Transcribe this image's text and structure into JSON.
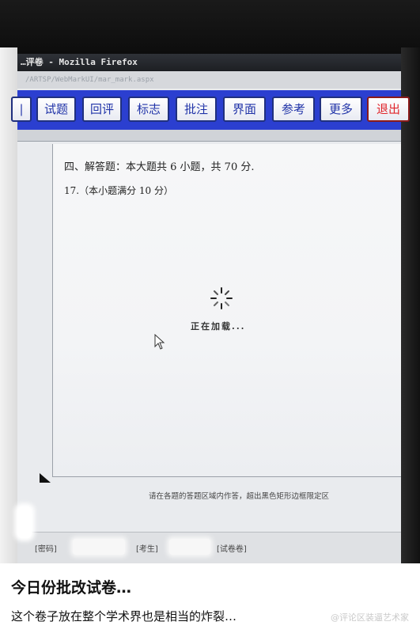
{
  "window": {
    "title": "…评卷 - Mozilla Firefox",
    "url": "/ARTSP/WebMarkUI/mar_mark.aspx"
  },
  "toolbar": {
    "buttons": [
      {
        "label": "|"
      },
      {
        "label": "试题"
      },
      {
        "label": "回评"
      },
      {
        "label": "标志"
      },
      {
        "label": "批注"
      },
      {
        "label": "界面"
      },
      {
        "label": "参考"
      },
      {
        "label": "更多"
      },
      {
        "label": "退出"
      }
    ]
  },
  "paper": {
    "section_heading": "四、解答题：本大题共 6 小题，共 70 分.",
    "question_label": "17.（本小题满分 10 分）",
    "loading_text": "正在加载...",
    "footer_note": "请在各题的答题区域内作答，超出黑色矩形边框限定区"
  },
  "status": {
    "label_1": "[密码]",
    "label_2": "[考生]",
    "label_3": "[试卷卷]"
  },
  "caption": {
    "title": "今日份批改试卷…",
    "body": "这个卷子放在整个学术界也是相当的炸裂…"
  },
  "watermark": "@评论区装逼艺术家",
  "colors": {
    "toolbar_bg": "#2b3fd0",
    "button_text": "#2033a8",
    "exit_text": "#e0262c"
  }
}
